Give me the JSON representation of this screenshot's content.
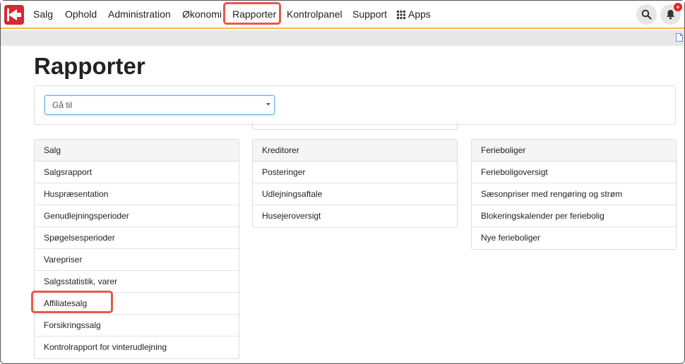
{
  "nav": {
    "items": [
      "Salg",
      "Ophold",
      "Administration",
      "Økonomi",
      "Rapporter",
      "Kontrolpanel",
      "Support",
      "Apps"
    ],
    "active": "Rapporter",
    "notification_count": "+"
  },
  "page": {
    "title": "Rapporter"
  },
  "goto": {
    "placeholder": "Gå til"
  },
  "panels": [
    {
      "heading": "Salg",
      "items": [
        "Salgsrapport",
        "Huspræsentation",
        "Genudlejningsperioder",
        "Spøgelsesperioder",
        "Varepriser",
        "Salgsstatistik, varer",
        "Affiliatesalg",
        "Forsikringssalg",
        "Kontrolrapport for vinterudlejning"
      ]
    },
    {
      "heading": "Kreditorer",
      "items": [
        "Posteringer",
        "Udlejningsaftale",
        "Husejeroversigt"
      ]
    },
    {
      "heading": "Ferieboliger",
      "items": [
        "Ferieboligoversigt",
        "Sæsonpriser med rengøring og strøm",
        "Blokeringskalender per feriebolig",
        "Nye ferieboliger"
      ]
    }
  ],
  "highlighted_item": "Affiliatesalg",
  "colors": {
    "brand": "#d9282f",
    "nav_underline": "#f5b942",
    "highlight": "#e8584a"
  }
}
